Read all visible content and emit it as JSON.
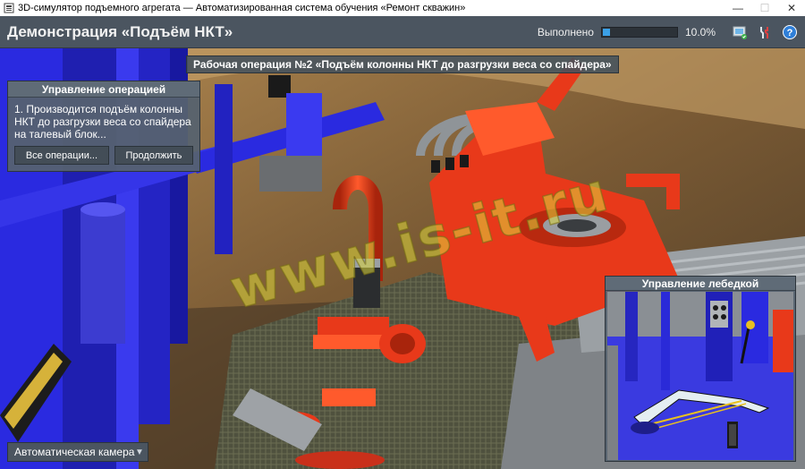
{
  "window": {
    "title": "3D-симулятор подъемного агрегата — Автоматизированная система обучения «Ремонт скважин»",
    "controls": [
      "—",
      "☐",
      "✕"
    ]
  },
  "header": {
    "title": "Демонстрация «Подъём НКТ»",
    "progress_label": "Выполнено",
    "progress_value": "10.0%",
    "progress_fraction": 0.1,
    "icons": [
      "camera-screen-icon",
      "tools-icon",
      "help-icon"
    ],
    "help_glyph": "?"
  },
  "scene": {
    "operation_banner": "Рабочая операция №2 «Подъём колонны НКТ до разгрузки веса со спайдера»",
    "watermark": "www.is-it.ru"
  },
  "operation_panel": {
    "title": "Управление операцией",
    "text": "1. Производится подъём колонны НКТ до разгрузки веса со спайдера на талевый блок...",
    "all_operations_button": "Все операции...",
    "continue_button": "Продолжить"
  },
  "winch_panel": {
    "title": "Управление лебедкой"
  },
  "camera": {
    "selected": "Автоматическая камера",
    "arrow": "▼"
  },
  "colors": {
    "header_bg": "#4b5560",
    "panel_bg": "#56626e",
    "progress_fill": "#3ba0e6",
    "equipment_red": "#e8391a",
    "frame_blue": "#2a2ae0",
    "watermark": "#dcd73c"
  }
}
